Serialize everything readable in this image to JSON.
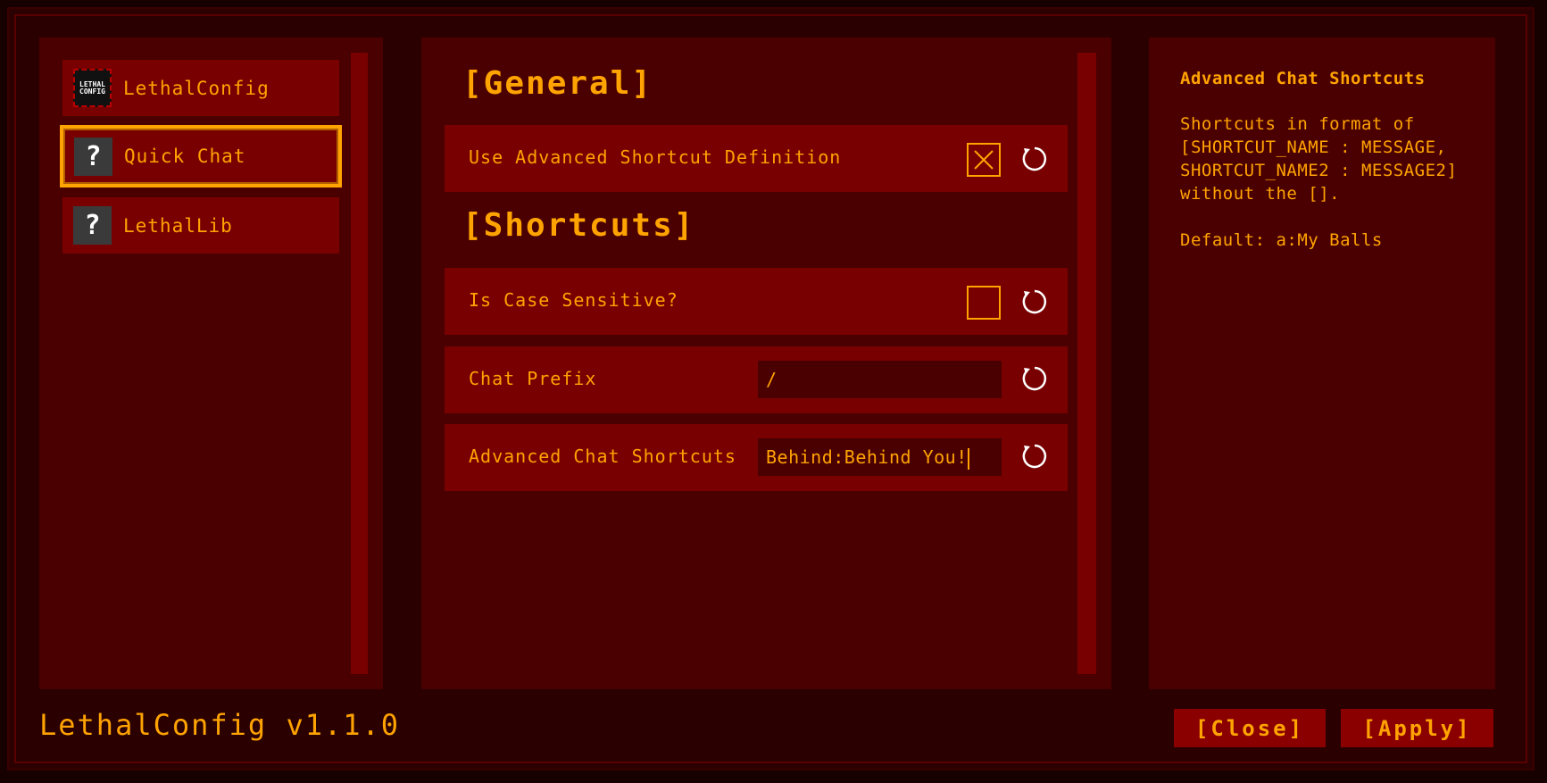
{
  "sidebar": {
    "items": [
      {
        "label": "LethalConfig",
        "icon": "lethalconfig-logo-icon",
        "logo_text": "LETHAL CONFIG",
        "selected": false
      },
      {
        "label": "Quick Chat",
        "icon": "question-mark-icon",
        "glyph": "?",
        "selected": true
      },
      {
        "label": "LethalLib",
        "icon": "question-mark-icon",
        "glyph": "?",
        "selected": false
      }
    ]
  },
  "main": {
    "sections": [
      {
        "title": "[General]"
      },
      {
        "title": "[Shortcuts]"
      }
    ],
    "rows": [
      {
        "label": "Use Advanced Shortcut Definition",
        "type": "checkbox",
        "checked": true
      },
      {
        "label": "Is Case Sensitive?",
        "type": "checkbox",
        "checked": false
      },
      {
        "label": "Chat Prefix",
        "type": "text",
        "value": "/"
      },
      {
        "label": "Advanced Chat Shortcuts",
        "type": "text",
        "value": "Behind:Behind You!"
      }
    ]
  },
  "description": {
    "title": "Advanced Chat Shortcuts",
    "body_lines": [
      "Shortcuts in format of",
      "[SHORTCUT_NAME : MESSAGE,",
      "SHORTCUT_NAME2 : MESSAGE2]",
      "without the []."
    ],
    "default": "Default: a:My Balls"
  },
  "footer": {
    "version": "LethalConfig v1.1.0",
    "close_label": "[Close]",
    "apply_label": "[Apply]"
  },
  "colors": {
    "accent": "#ffa300",
    "panel": "#4a0000",
    "row": "#780000",
    "background": "#2a0000"
  }
}
